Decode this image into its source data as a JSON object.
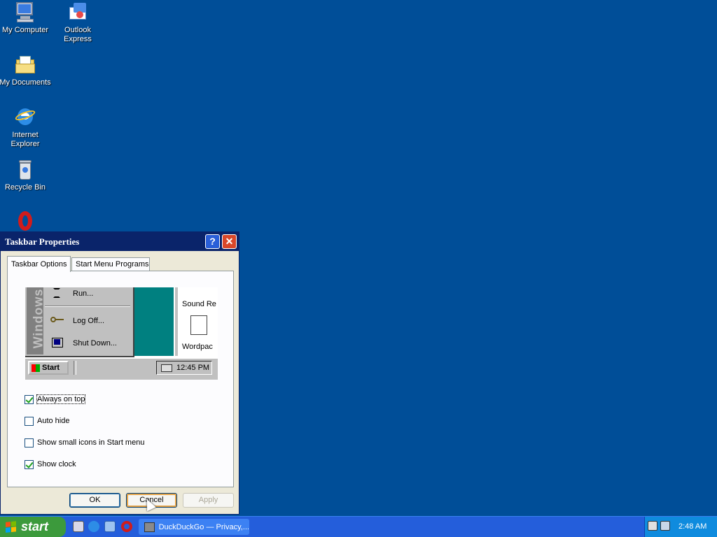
{
  "desktop": {
    "icons": [
      {
        "label": "My Computer",
        "icon": "my-computer-icon"
      },
      {
        "label": "Outlook Express",
        "icon": "outlook-express-icon"
      },
      {
        "label": "My Documents",
        "icon": "my-documents-icon"
      },
      {
        "label": "Internet Explorer",
        "icon": "internet-explorer-icon"
      },
      {
        "label": "Recycle Bin",
        "icon": "recycle-bin-icon"
      },
      {
        "label": "",
        "icon": "opera-icon"
      }
    ],
    "background_color": "#004e98"
  },
  "dialog": {
    "title": "Taskbar Properties",
    "help_button": "?",
    "close_button": "✕",
    "tabs": [
      {
        "label": "Taskbar Options",
        "active": true
      },
      {
        "label": "Start Menu Programs",
        "active": false
      }
    ],
    "preview": {
      "sidebar_text": "Windows",
      "menu_items": [
        "Run...",
        "Log Off...",
        "Shut Down..."
      ],
      "right_items": [
        "Sound Re",
        "Wordpac"
      ],
      "start_label": "Start",
      "tray_time": "12:45 PM"
    },
    "options": [
      {
        "label": "Always on top",
        "checked": true
      },
      {
        "label": "Auto hide",
        "checked": false
      },
      {
        "label": "Show small icons in Start menu",
        "checked": false
      },
      {
        "label": "Show clock",
        "checked": true
      }
    ],
    "buttons": {
      "ok": "OK",
      "cancel": "Cancel",
      "apply": "Apply"
    }
  },
  "taskbar": {
    "start_label": "start",
    "quick_launch": [
      "show-desktop-icon",
      "internet-explorer-icon",
      "outlook-express-icon",
      "opera-icon"
    ],
    "active_task": "DuckDuckGo — Privacy,...",
    "clock": "2:48 AM"
  }
}
